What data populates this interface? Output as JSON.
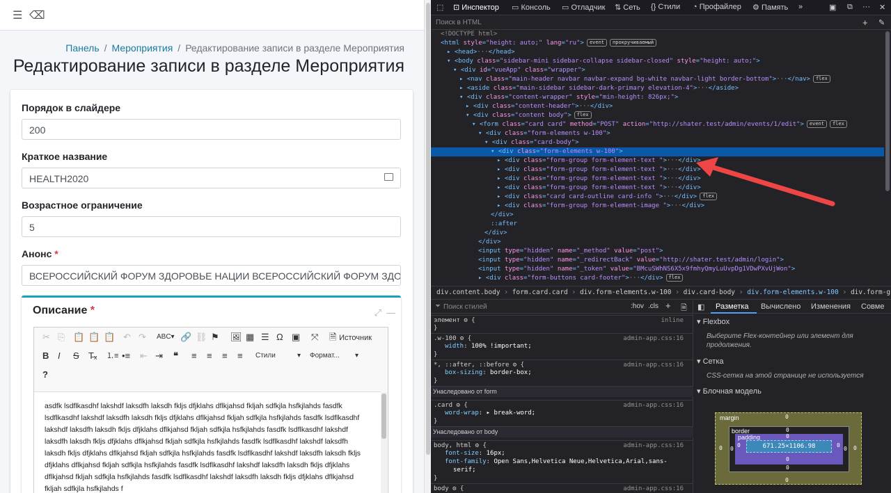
{
  "page": {
    "breadcrumbs": [
      "Панель",
      "Мероприятия",
      "Редактирование записи в разделе Мероприятия"
    ],
    "title": "Редактирование записи в разделе Мероприятия"
  },
  "form": {
    "fields": [
      {
        "label": "Порядок в слайдере",
        "value": "200"
      },
      {
        "label": "Краткое название",
        "value": "HEALTH2020"
      },
      {
        "label": "Возрастное ограничение",
        "value": "5"
      },
      {
        "label": "Анонс",
        "required_mark": "*",
        "value": "ВСЕРОССИЙСКИЙ ФОРУМ ЗДОРОВЬЕ НАЦИИ ВСЕРОССИЙСКИЙ ФОРУМ ЗДОРОВЬЕ НАЦИИ"
      }
    ],
    "description": {
      "label": "Описание",
      "required_mark": "*",
      "source_button": "Источник",
      "styles_dropdown": "Стили",
      "format_dropdown": "Формат...",
      "help": "?",
      "body_lines": [
        "asdfk lsdflkasdhf lakshdf laksdfh laksdh fkljs dfjklahs dflkjahsd fkljah sdfkjla hsfkjlahds fasdfk",
        "lsdflkasdhf lakshdf laksdfh laksdh fkljs dfjklahs dflkjahsd fkljah sdfkjla hsfkjlahds fasdfk lsdflkasdhf",
        "lakshdf laksdfh laksdh fkljs dfjklahs dflkjahsd fkljah sdfkjla hsfkjlahds fasdfk lsdflkasdhf lakshdf",
        "laksdfh laksdh fkljs dfjklahs dflkjahsd fkljah sdfkjla hsfkjlahds fasdfk lsdflkasdhf lakshdf laksdfh",
        "laksdh fkljs dfjklahs dflkjahsd fkljah sdfkjla hsfkjlahds fasdfk lsdflkasdhf lakshdf laksdfh laksdh fkljs",
        "dfjklahs dflkjahsd fkljah sdfkjla hsfkjlahds fasdfk lsdflkasdhf lakshdf laksdfh laksdh fkljs dfjklahs",
        "dflkjahsd fkljah sdfkjla hsfkjlahds fasdfk lsdflkasdhf lakshdf laksdfh laksdh fkljs dfjklahs dflkjahsd",
        "fkljah sdfkjla hsfkjlahds f"
      ]
    }
  },
  "devtools": {
    "tabs": [
      "Инспектор",
      "Консоль",
      "Отладчик",
      "Сеть",
      "Стили",
      "Профайлер",
      "Память"
    ],
    "search_placeholder": "Поиск в HTML",
    "tree": [
      {
        "indent": 0,
        "seg": [
          [
            "cm",
            "<!DOCTYPE html>"
          ]
        ]
      },
      {
        "indent": 0,
        "seg": [
          [
            "tg",
            "<html "
          ],
          [
            "at",
            "style"
          ],
          [
            "tg",
            "="
          ],
          [
            "av",
            "\"height: auto;\""
          ],
          [
            "tg",
            " "
          ],
          [
            "at",
            "lang"
          ],
          [
            "tg",
            "="
          ],
          [
            "av",
            "\"ru\""
          ],
          [
            "tg",
            ">"
          ]
        ],
        "badges": [
          "event",
          "прокручиваемый"
        ]
      },
      {
        "indent": 1,
        "seg": [
          [
            "tg",
            "▸ <head>"
          ],
          [
            "cm",
            "···"
          ],
          [
            "tg",
            "</head>"
          ]
        ]
      },
      {
        "indent": 1,
        "seg": [
          [
            "tg",
            "▾ <body "
          ],
          [
            "at",
            "class"
          ],
          [
            "tg",
            "="
          ],
          [
            "av",
            "\"sidebar-mini sidebar-collapse sidebar-closed\""
          ],
          [
            "tg",
            " "
          ],
          [
            "at",
            "style"
          ],
          [
            "tg",
            "="
          ],
          [
            "av",
            "\"height: auto;\""
          ],
          [
            "tg",
            ">"
          ]
        ]
      },
      {
        "indent": 2,
        "seg": [
          [
            "tg",
            "▾ <div "
          ],
          [
            "at",
            "id"
          ],
          [
            "tg",
            "="
          ],
          [
            "av",
            "\"vueApp\""
          ],
          [
            "tg",
            " "
          ],
          [
            "at",
            "class"
          ],
          [
            "tg",
            "="
          ],
          [
            "av",
            "\"wrapper\""
          ],
          [
            "tg",
            ">"
          ]
        ]
      },
      {
        "indent": 3,
        "seg": [
          [
            "tg",
            "▸ <nav "
          ],
          [
            "at",
            "class"
          ],
          [
            "tg",
            "="
          ],
          [
            "av",
            "\"main-header navbar navbar-expand bg-white navbar-light border-bottom\""
          ],
          [
            "tg",
            ">"
          ],
          [
            "cm",
            "···"
          ],
          [
            "tg",
            "</nav>"
          ]
        ],
        "badges": [
          "flex"
        ]
      },
      {
        "indent": 3,
        "seg": [
          [
            "tg",
            "▸ <aside "
          ],
          [
            "at",
            "class"
          ],
          [
            "tg",
            "="
          ],
          [
            "av",
            "\"main-sidebar sidebar-dark-primary elevation-4\""
          ],
          [
            "tg",
            ">"
          ],
          [
            "cm",
            "···"
          ],
          [
            "tg",
            "</aside>"
          ]
        ]
      },
      {
        "indent": 3,
        "seg": [
          [
            "tg",
            "▾ <div "
          ],
          [
            "at",
            "class"
          ],
          [
            "tg",
            "="
          ],
          [
            "av",
            "\"content-wrapper\""
          ],
          [
            "tg",
            " "
          ],
          [
            "at",
            "style"
          ],
          [
            "tg",
            "="
          ],
          [
            "av",
            "\"min-height: 826px;\""
          ],
          [
            "tg",
            ">"
          ]
        ]
      },
      {
        "indent": 4,
        "seg": [
          [
            "tg",
            "▸ <div "
          ],
          [
            "at",
            "class"
          ],
          [
            "tg",
            "="
          ],
          [
            "av",
            "\"content-header\""
          ],
          [
            "tg",
            ">"
          ],
          [
            "cm",
            "···"
          ],
          [
            "tg",
            "</div>"
          ]
        ]
      },
      {
        "indent": 4,
        "seg": [
          [
            "tg",
            "▾ <div "
          ],
          [
            "at",
            "class"
          ],
          [
            "tg",
            "="
          ],
          [
            "av",
            "\"content body\""
          ],
          [
            "tg",
            ">"
          ]
        ],
        "badges": [
          "flex"
        ]
      },
      {
        "indent": 5,
        "seg": [
          [
            "tg",
            "▾ <form "
          ],
          [
            "at",
            "class"
          ],
          [
            "tg",
            "="
          ],
          [
            "av",
            "\"card card\""
          ],
          [
            "tg",
            " "
          ],
          [
            "at",
            "method"
          ],
          [
            "tg",
            "="
          ],
          [
            "av",
            "\"POST\""
          ],
          [
            "tg",
            " "
          ],
          [
            "at",
            "action"
          ],
          [
            "tg",
            "="
          ],
          [
            "av",
            "\"http://shater.test/admin/events/1/edit\""
          ],
          [
            "tg",
            ">"
          ]
        ],
        "badges": [
          "event",
          "flex"
        ]
      },
      {
        "indent": 6,
        "seg": [
          [
            "tg",
            "▾ <div "
          ],
          [
            "at",
            "class"
          ],
          [
            "tg",
            "="
          ],
          [
            "av",
            "\"form-elements w-100\""
          ],
          [
            "tg",
            ">"
          ]
        ]
      },
      {
        "indent": 7,
        "seg": [
          [
            "tg",
            "▾ <div "
          ],
          [
            "at",
            "class"
          ],
          [
            "tg",
            "="
          ],
          [
            "av",
            "\"card-body\""
          ],
          [
            "tg",
            ">"
          ]
        ]
      },
      {
        "indent": 8,
        "sel": true,
        "seg": [
          [
            "tg",
            "▾ <div "
          ],
          [
            "at",
            "class"
          ],
          [
            "tg",
            "="
          ],
          [
            "av",
            "\"form-elements w-100\""
          ],
          [
            "tg",
            ">"
          ]
        ]
      },
      {
        "indent": 9,
        "seg": [
          [
            "tg",
            "▸ <div "
          ],
          [
            "at",
            "class"
          ],
          [
            "tg",
            "="
          ],
          [
            "av",
            "\"form-group form-element-text \""
          ],
          [
            "tg",
            ">"
          ],
          [
            "cm",
            "···"
          ],
          [
            "tg",
            "</div>"
          ]
        ]
      },
      {
        "indent": 9,
        "seg": [
          [
            "tg",
            "▸ <div "
          ],
          [
            "at",
            "class"
          ],
          [
            "tg",
            "="
          ],
          [
            "av",
            "\"form-group form-element-text \""
          ],
          [
            "tg",
            ">"
          ],
          [
            "cm",
            "···"
          ],
          [
            "tg",
            "</div>"
          ]
        ]
      },
      {
        "indent": 9,
        "seg": [
          [
            "tg",
            "▸ <div "
          ],
          [
            "at",
            "class"
          ],
          [
            "tg",
            "="
          ],
          [
            "av",
            "\"form-group form-element-text \""
          ],
          [
            "tg",
            ">"
          ],
          [
            "cm",
            "···"
          ],
          [
            "tg",
            "</div>"
          ]
        ]
      },
      {
        "indent": 9,
        "seg": [
          [
            "tg",
            "▸ <div "
          ],
          [
            "at",
            "class"
          ],
          [
            "tg",
            "="
          ],
          [
            "av",
            "\"form-group form-element-text \""
          ],
          [
            "tg",
            ">"
          ],
          [
            "cm",
            "···"
          ],
          [
            "tg",
            "</div>"
          ]
        ]
      },
      {
        "indent": 9,
        "seg": [
          [
            "tg",
            "▸ <div "
          ],
          [
            "at",
            "class"
          ],
          [
            "tg",
            "="
          ],
          [
            "av",
            "\"card card-outline card-info \""
          ],
          [
            "tg",
            ">"
          ],
          [
            "cm",
            "···"
          ],
          [
            "tg",
            "</div>"
          ]
        ],
        "badges": [
          "flex"
        ]
      },
      {
        "indent": 9,
        "seg": [
          [
            "tg",
            "▸ <div "
          ],
          [
            "at",
            "class"
          ],
          [
            "tg",
            "="
          ],
          [
            "av",
            "\"form-group form-element-image \""
          ],
          [
            "tg",
            ">"
          ],
          [
            "cm",
            "···"
          ],
          [
            "tg",
            "</div>"
          ]
        ]
      },
      {
        "indent": 8,
        "seg": [
          [
            "tg",
            "</div>"
          ]
        ]
      },
      {
        "indent": 8,
        "seg": [
          [
            "tg",
            "::after"
          ]
        ]
      },
      {
        "indent": 7,
        "seg": [
          [
            "tg",
            "</div>"
          ]
        ]
      },
      {
        "indent": 6,
        "seg": [
          [
            "tg",
            "</div>"
          ]
        ]
      },
      {
        "indent": 6,
        "seg": [
          [
            "tg",
            "<input "
          ],
          [
            "at",
            "type"
          ],
          [
            "tg",
            "="
          ],
          [
            "av",
            "\"hidden\""
          ],
          [
            "tg",
            " "
          ],
          [
            "at",
            "name"
          ],
          [
            "tg",
            "="
          ],
          [
            "av",
            "\"_method\""
          ],
          [
            "tg",
            " "
          ],
          [
            "at",
            "value"
          ],
          [
            "tg",
            "="
          ],
          [
            "av",
            "\"post\""
          ],
          [
            "tg",
            ">"
          ]
        ]
      },
      {
        "indent": 6,
        "seg": [
          [
            "tg",
            "<input "
          ],
          [
            "at",
            "type"
          ],
          [
            "tg",
            "="
          ],
          [
            "av",
            "\"hidden\""
          ],
          [
            "tg",
            " "
          ],
          [
            "at",
            "name"
          ],
          [
            "tg",
            "="
          ],
          [
            "av",
            "\"_redirectBack\""
          ],
          [
            "tg",
            " "
          ],
          [
            "at",
            "value"
          ],
          [
            "tg",
            "="
          ],
          [
            "av",
            "\"http://shater.test/admin/login\""
          ],
          [
            "tg",
            ">"
          ]
        ]
      },
      {
        "indent": 6,
        "seg": [
          [
            "tg",
            "<input "
          ],
          [
            "at",
            "type"
          ],
          [
            "tg",
            "="
          ],
          [
            "av",
            "\"hidden\""
          ],
          [
            "tg",
            " "
          ],
          [
            "at",
            "name"
          ],
          [
            "tg",
            "="
          ],
          [
            "av",
            "\"_token\""
          ],
          [
            "tg",
            " "
          ],
          [
            "at",
            "value"
          ],
          [
            "tg",
            "="
          ],
          [
            "av",
            "\"BMcuSWhNS6X5x9fmhyQmyLuUvpDg1VDwPXvUjWon\""
          ],
          [
            "tg",
            ">"
          ]
        ]
      },
      {
        "indent": 6,
        "seg": [
          [
            "tg",
            "▸ <div "
          ],
          [
            "at",
            "class"
          ],
          [
            "tg",
            "="
          ],
          [
            "av",
            "\"form-buttons card-footer\""
          ],
          [
            "tg",
            ">"
          ],
          [
            "cm",
            "···"
          ],
          [
            "tg",
            "</div>"
          ]
        ],
        "badges": [
          "flex"
        ]
      }
    ],
    "breadcrumbs": [
      "div.content.body",
      "form.card.card",
      "div.form-elements.w-100",
      "div.card-body",
      "div.form-elements.w-100",
      "div.form-group.form-element-text."
    ],
    "styles_filter_placeholder": "Поиск стилей",
    "styles_buttons": [
      ":hov",
      ".cls",
      "+"
    ],
    "rules": [
      {
        "kind": "rule",
        "sel": "элемент ⚙ {",
        "src": "inline"
      },
      {
        "kind": "close",
        "text": "}"
      },
      {
        "kind": "rule",
        "sel": ".w-100 ⚙ {",
        "src": "admin-app.css:16"
      },
      {
        "kind": "prop",
        "name": "width",
        "value": "100% !important;"
      },
      {
        "kind": "close",
        "text": "}"
      },
      {
        "kind": "rule",
        "sel": "*, ::after, ::before ⚙ {",
        "src": "admin-app.css:16"
      },
      {
        "kind": "prop",
        "name": "box-sizing",
        "value": "border-box;"
      },
      {
        "kind": "close",
        "text": "}"
      },
      {
        "kind": "hdr",
        "text": "Унаследовано от form"
      },
      {
        "kind": "rule",
        "sel": ".card ⚙ {",
        "src": "admin-app.css:16"
      },
      {
        "kind": "prop",
        "name": "word-wrap",
        "value": "▸ break-word;"
      },
      {
        "kind": "close",
        "text": "}"
      },
      {
        "kind": "hdr",
        "text": "Унаследовано от body"
      },
      {
        "kind": "rule",
        "sel": "body, html ⚙ {",
        "src": "admin-app.css:16"
      },
      {
        "kind": "prop",
        "name": "font-size",
        "value": "16px;"
      },
      {
        "kind": "prop",
        "name": "font-family",
        "value": "Open Sans,Helvetica Neue,Helvetica,Arial,sans-"
      },
      {
        "kind": "cont",
        "text": "serif;"
      },
      {
        "kind": "close",
        "text": "}"
      },
      {
        "kind": "rule",
        "sel": "body ⚙ {",
        "src": "admin-app.css:16"
      }
    ],
    "layout_tabs": [
      "Разметка",
      "Вычислено",
      "Изменения",
      "Совме"
    ],
    "flexbox": {
      "title": "Flexbox",
      "text": "Выберите Flex-контейнер или элемент для продолжения."
    },
    "grid": {
      "title": "Сетка",
      "text": "CSS-сетка на этой странице не используется"
    },
    "boxmodel": {
      "title": "Блочная модель",
      "margin_label": "margin",
      "border_label": "border",
      "padding_label": "padding",
      "size": "671.25×1106.98",
      "zero": "0"
    }
  }
}
